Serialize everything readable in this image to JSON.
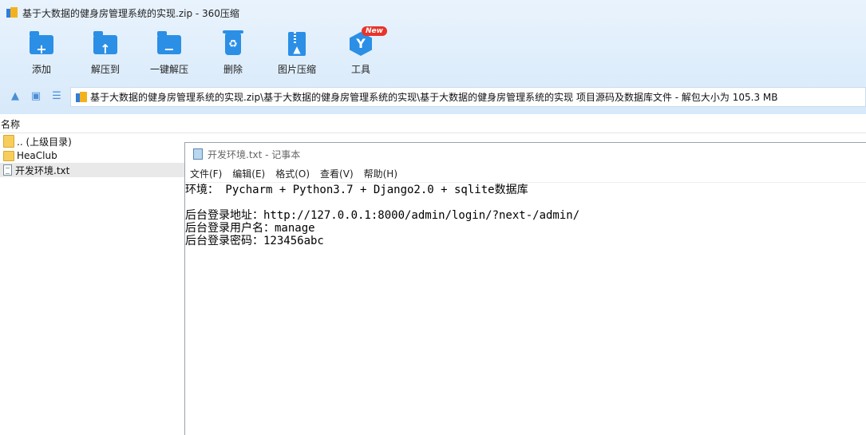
{
  "window": {
    "title": "基于大数据的健身房管理系统的实现.zip - 360压缩"
  },
  "toolbar": {
    "items": [
      {
        "label": "添加",
        "icon": "add-folder-icon"
      },
      {
        "label": "解压到",
        "icon": "extract-to-icon"
      },
      {
        "label": "一键解压",
        "icon": "one-click-extract-icon"
      },
      {
        "label": "删除",
        "icon": "recycle-bin-icon"
      },
      {
        "label": "图片压缩",
        "icon": "image-compress-icon"
      },
      {
        "label": "工具",
        "icon": "tools-icon",
        "badge": "New"
      }
    ]
  },
  "navbar": {
    "path": "基于大数据的健身房管理系统的实现.zip\\基于大数据的健身房管理系统的实现\\基于大数据的健身房管理系统的实现  项目源码及数据库文件 - 解包大小为 105.3 MB"
  },
  "file_list": {
    "column_header": "名称",
    "rows": [
      {
        "name": ".. (上级目录)",
        "type": "folder-up"
      },
      {
        "name": "HeaClub",
        "type": "folder"
      },
      {
        "name": "开发环境.txt",
        "type": "file",
        "selected": true
      }
    ]
  },
  "notepad": {
    "title": "开发环境.txt - 记事本",
    "menu": [
      "文件(F)",
      "编辑(E)",
      "格式(O)",
      "查看(V)",
      "帮助(H)"
    ],
    "lines": [
      "环境： Pycharm + Python3.7 + Django2.0 + sqlite数据库",
      "",
      "后台登录地址：http://127.0.0.1:8000/admin/login/?next-/admin/",
      "后台登录用户名：manage",
      "后台登录密码：123456abc"
    ]
  },
  "colors": {
    "accent": "#2b8fe6",
    "badge": "#e8342b",
    "toolbar_bg": "#dbeafa"
  }
}
